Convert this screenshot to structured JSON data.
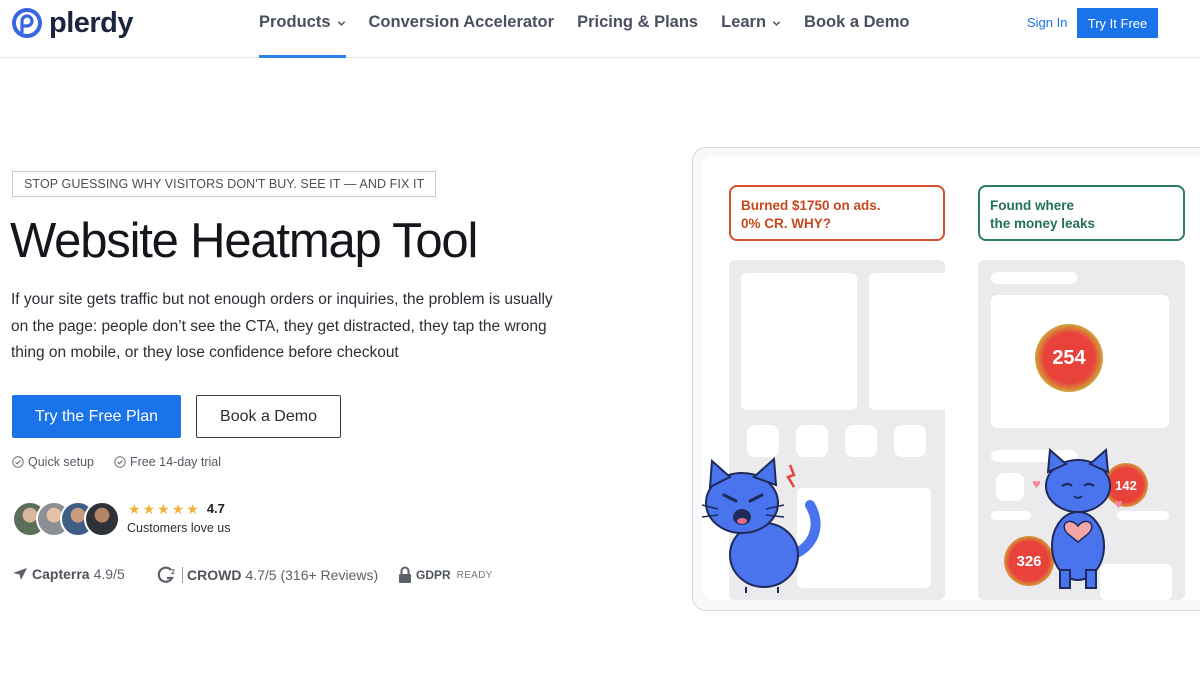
{
  "brand": {
    "name": "plerdy",
    "color": "#3a67e0"
  },
  "nav": {
    "items": [
      {
        "label": "Products",
        "has_dropdown": true,
        "active": true
      },
      {
        "label": "Conversion Accelerator",
        "has_dropdown": false
      },
      {
        "label": "Pricing & Plans",
        "has_dropdown": false
      },
      {
        "label": "Learn",
        "has_dropdown": true
      },
      {
        "label": "Book a Demo",
        "has_dropdown": false
      }
    ],
    "sign_in": "Sign In",
    "try_free": "Try It Free"
  },
  "hero": {
    "eyebrow": "STOP GUESSING WHY VISITORS DON'T BUY. SEE IT — AND FIX IT",
    "title": "Website Heatmap Tool",
    "description": "If your site gets traffic but not enough orders or inquiries, the problem is usually on the page: people don’t see the CTA, they get distracted, they tap the wrong thing on mobile, or they lose confidence before checkout",
    "primary_cta": "Try the Free Plan",
    "secondary_cta": "Book a Demo",
    "perks": [
      "Quick setup",
      "Free 14-day trial"
    ],
    "rating": {
      "stars": 5,
      "value": "4.7",
      "caption": "Customers love us"
    },
    "trust": {
      "capterra_name": "Capterra",
      "capterra_score": "4.9/5",
      "g2_name": "CROWD",
      "g2_score": "4.7/5 (316+ Reviews)",
      "gdpr": "GDPR",
      "gdpr_small": "READY"
    }
  },
  "illustration": {
    "callout_left": [
      "Burned $1750 on ads.",
      "0% CR. WHY?"
    ],
    "callout_right": [
      "Found where",
      "the money leaks"
    ],
    "hotspots": [
      "254",
      "142",
      "326"
    ],
    "colors": {
      "hot_red": "#e8423b",
      "hot_ring": "#c4d23a",
      "cat_blue": "#4a73ee"
    }
  }
}
